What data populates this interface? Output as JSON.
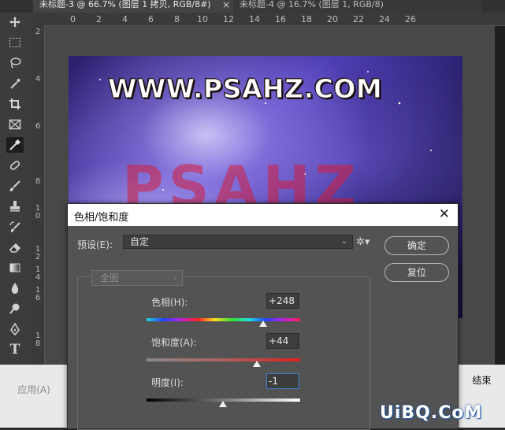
{
  "tabs": [
    {
      "label": "未标题-3 @ 66.7% (图层 1 拷贝, RGB/8#)",
      "close": "×"
    },
    {
      "label": "未标题-4 @ 16.7% (图层 1, RGB/8)",
      "close": "×"
    }
  ],
  "ruler": {
    "horizontal": [
      "0",
      "2",
      "4",
      "6",
      "8",
      "10",
      "12",
      "14",
      "16",
      "18",
      "20",
      "22",
      "24",
      "26"
    ],
    "vertical": [
      "2",
      "4",
      "6",
      "8",
      "1\n0",
      "1\n2",
      "1\n4",
      "1\n6",
      "1\n8"
    ]
  },
  "tools": [
    "move-icon",
    "marquee-icon",
    "lasso-icon",
    "quick-select-icon",
    "crop-icon",
    "frame-icon",
    "eyedropper-icon",
    "healing-icon",
    "brush-icon",
    "stamp-icon",
    "history-brush-icon",
    "eraser-icon",
    "gradient-icon",
    "blur-icon",
    "dodge-icon",
    "pen-icon",
    "type-icon"
  ],
  "canvas": {
    "watermark": "WWW.PSAHZ.COM",
    "art_text": "PSAHZ"
  },
  "background_buttons": {
    "apply": "应用(A)",
    "end": "结束"
  },
  "dialog": {
    "title": "色相/饱和度",
    "close": "✕",
    "preset_label": "预设(E):",
    "preset_value": "自定",
    "ok": "确定",
    "reset": "复位",
    "range": "全图",
    "hue_label": "色相(H):",
    "hue_value": "+248",
    "saturation_label": "饱和度(A):",
    "saturation_value": "+44",
    "lightness_label": "明度(I):",
    "lightness_value": "-1",
    "hue_min": -180,
    "hue_max": 180,
    "hue": 248,
    "sat_min": -100,
    "sat_max": 100,
    "sat": 44,
    "light_min": -100,
    "light_max": 100,
    "light": -1
  },
  "site_logo": "UiBQ.CoM"
}
